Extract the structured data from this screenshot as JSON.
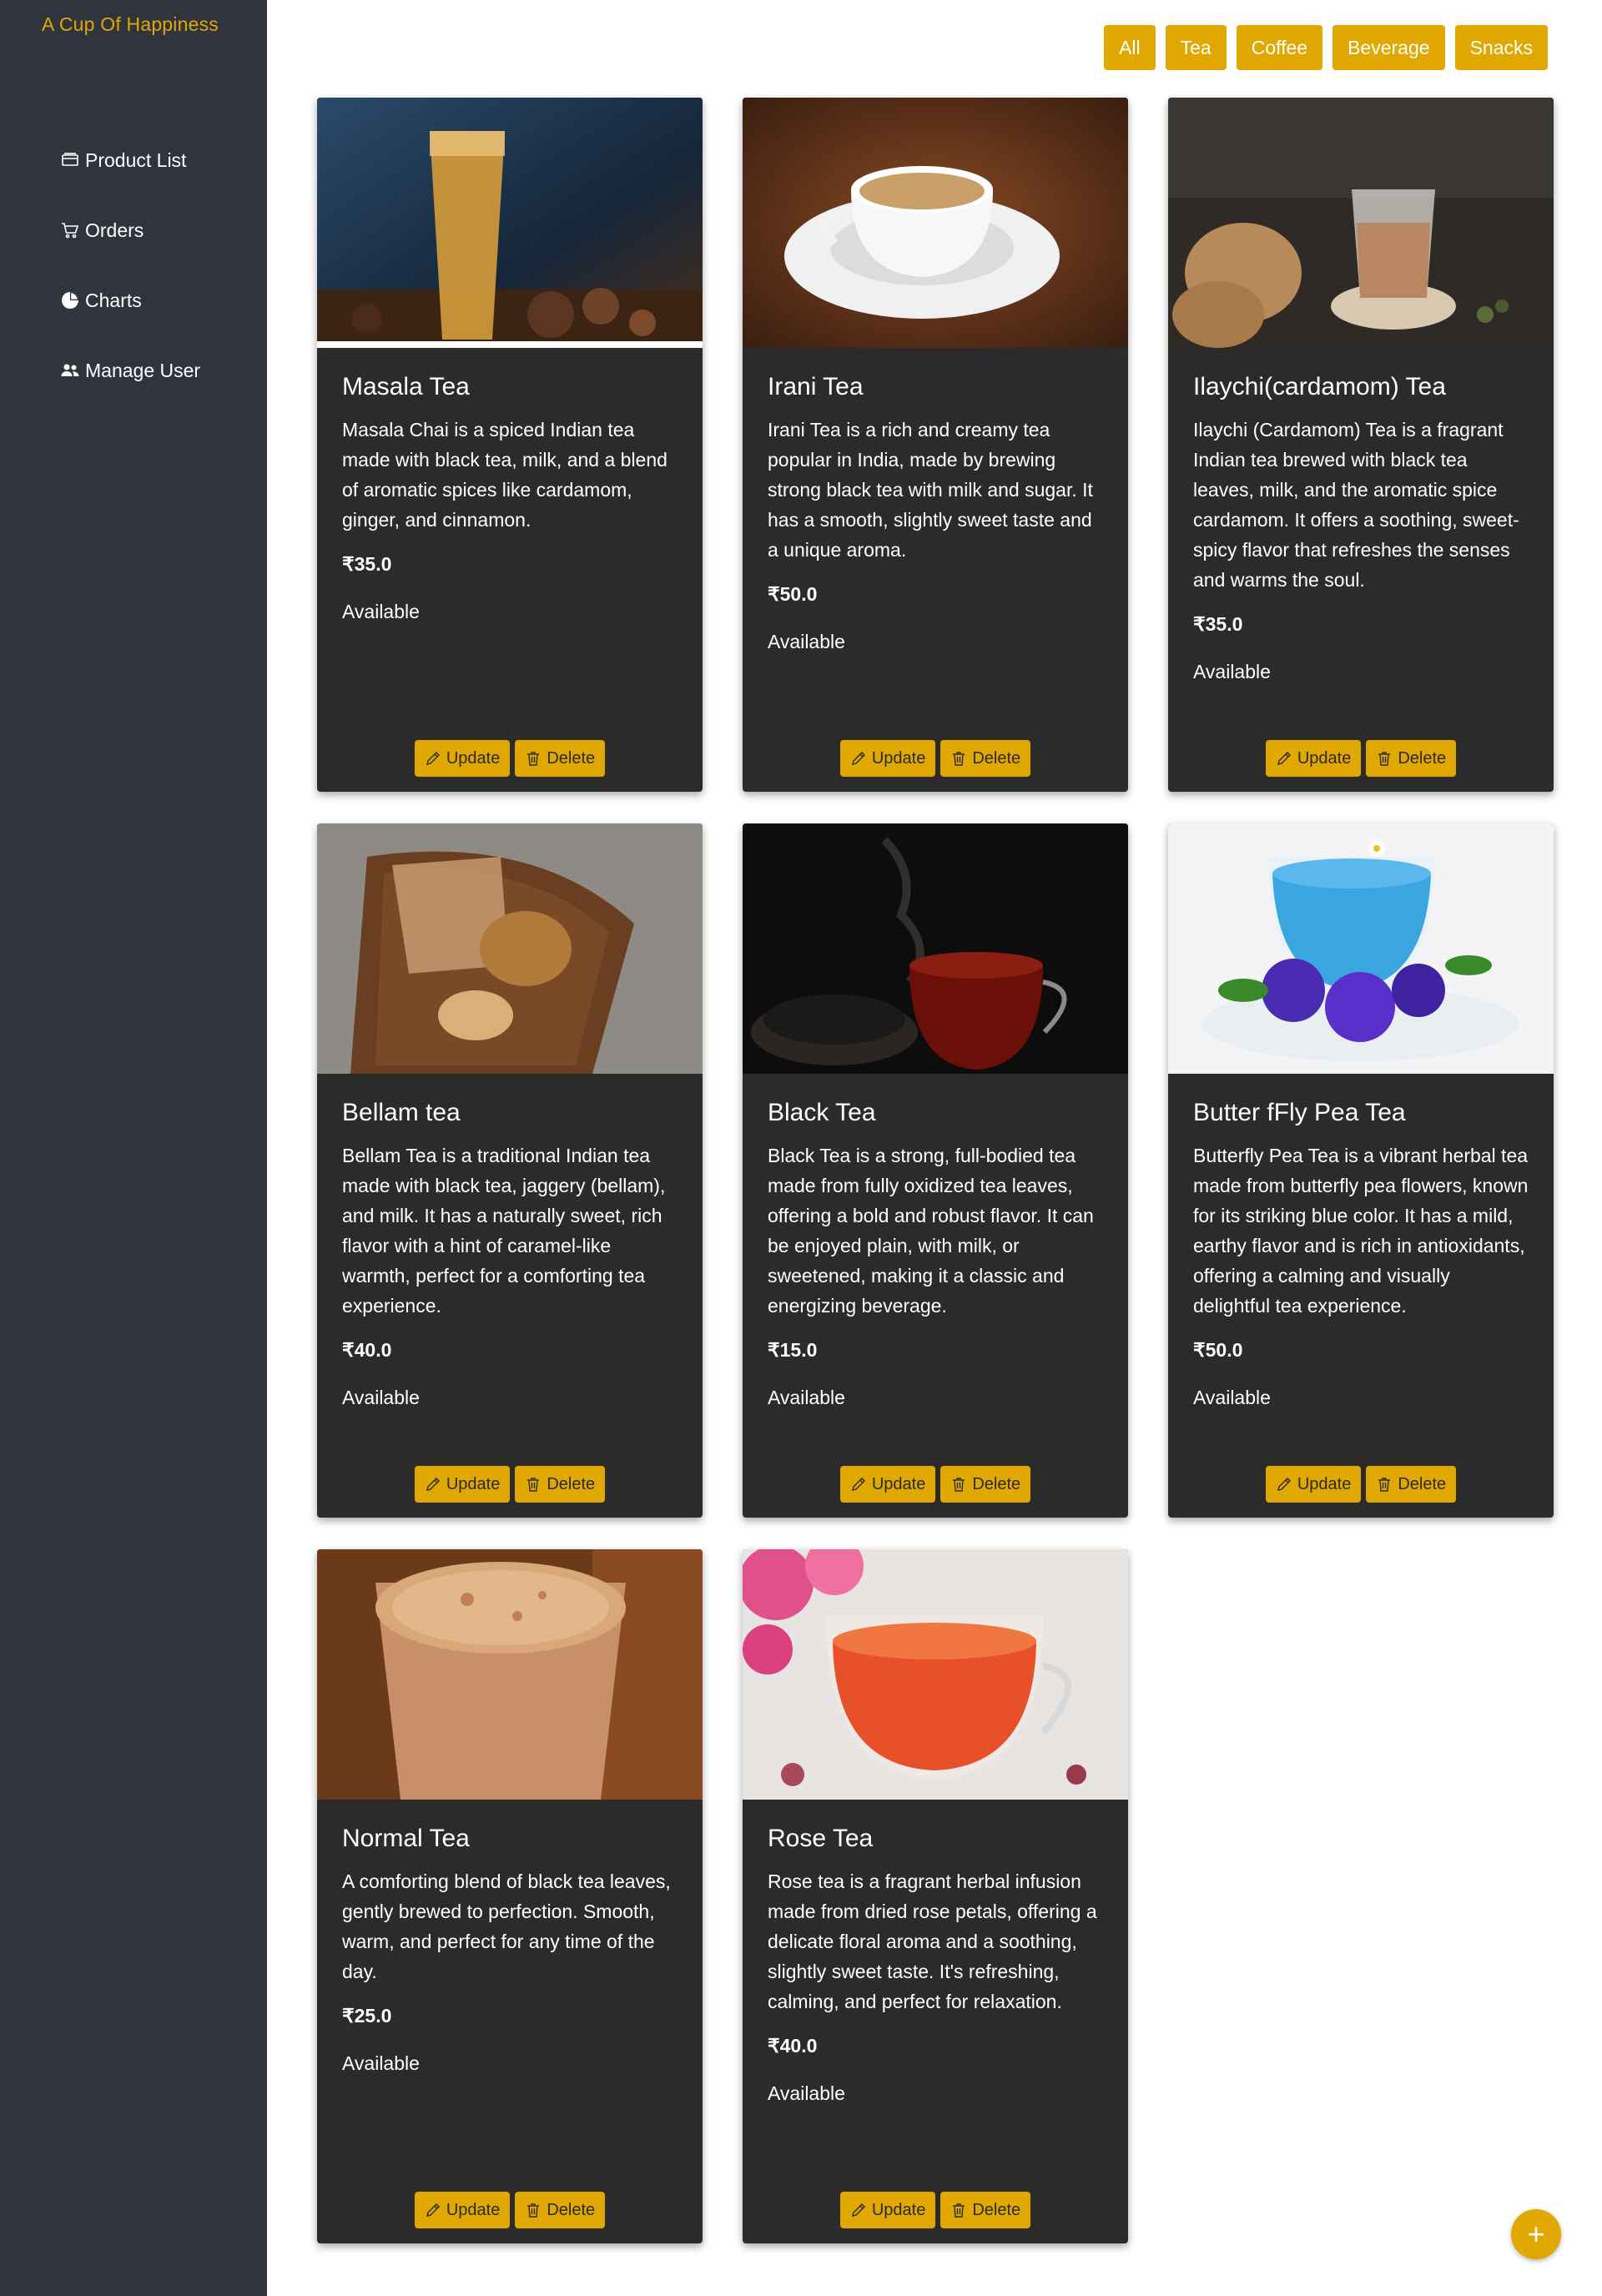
{
  "brand": "A Cup Of Happiness",
  "colors": {
    "accent": "#e0a800",
    "sidebar": "#2f343d",
    "card": "#2b2b2b"
  },
  "nav": [
    {
      "label": "Product List",
      "icon": "list-icon"
    },
    {
      "label": "Orders",
      "icon": "cart-icon"
    },
    {
      "label": "Charts",
      "icon": "pie-chart-icon"
    },
    {
      "label": "Manage User",
      "icon": "users-icon"
    }
  ],
  "filters": [
    "All",
    "Tea",
    "Coffee",
    "Beverage",
    "Snacks"
  ],
  "actions": {
    "update": "Update",
    "delete": "Delete"
  },
  "fab": "+",
  "products": [
    {
      "name": "Masala Tea",
      "description": "Masala Chai is a spiced Indian tea made with black tea, milk, and a blend of aromatic spices like cardamom, ginger, and cinnamon.",
      "price": "₹35.0",
      "status": "Available"
    },
    {
      "name": "Irani Tea",
      "description": "Irani Tea is a rich and creamy tea popular in India, made by brewing strong black tea with milk and sugar. It has a smooth, slightly sweet taste and a unique aroma.",
      "price": "₹50.0",
      "status": "Available"
    },
    {
      "name": "Ilaychi(cardamom) Tea",
      "description": "Ilaychi (Cardamom) Tea is a fragrant Indian tea brewed with black tea leaves, milk, and the aromatic spice cardamom. It offers a soothing, sweet-spicy flavor that refreshes the senses and warms the soul.",
      "price": "₹35.0",
      "status": "Available"
    },
    {
      "name": "Bellam tea",
      "description": "Bellam Tea is a traditional Indian tea made with black tea, jaggery (bellam), and milk. It has a naturally sweet, rich flavor with a hint of caramel-like warmth, perfect for a comforting tea experience.",
      "price": "₹40.0",
      "status": "Available"
    },
    {
      "name": "Black Tea",
      "description": "Black Tea is a strong, full-bodied tea made from fully oxidized tea leaves, offering a bold and robust flavor. It can be enjoyed plain, with milk, or sweetened, making it a classic and energizing beverage.",
      "price": "₹15.0",
      "status": "Available"
    },
    {
      "name": "Butter fFly Pea Tea",
      "description": "Butterfly Pea Tea is a vibrant herbal tea made from butterfly pea flowers, known for its striking blue color. It has a mild, earthy flavor and is rich in antioxidants, offering a calming and visually delightful tea experience.",
      "price": "₹50.0",
      "status": "Available"
    },
    {
      "name": "Normal Tea",
      "description": "A comforting blend of black tea leaves, gently brewed to perfection. Smooth, warm, and perfect for any time of the day.",
      "price": "₹25.0",
      "status": "Available"
    },
    {
      "name": "Rose Tea",
      "description": "Rose tea is a fragrant herbal infusion made from dried rose petals, offering a delicate floral aroma and a soothing, slightly sweet taste. It's refreshing, calming, and perfect for relaxation.",
      "price": "₹40.0",
      "status": "Available"
    }
  ]
}
